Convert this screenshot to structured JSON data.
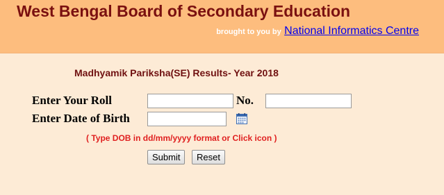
{
  "header": {
    "title": "West Bengal Board of Secondary Education",
    "brought_by": "brought to you by",
    "nic_link": "National Informatics Centre"
  },
  "form": {
    "heading": "Madhyamik Pariksha(SE) Results- Year 2018",
    "roll_label": "Enter Your Roll",
    "roll_value": "",
    "no_label": "No.",
    "no_value": "",
    "dob_label": "Enter Date of Birth",
    "dob_value": "",
    "dob_hint": "( Type DOB in dd/mm/yyyy format or Click icon   )",
    "calendar_icon": "calendar-icon",
    "submit_label": "Submit",
    "reset_label": "Reset"
  },
  "colors": {
    "header_bg": "#fdbd7e",
    "page_bg": "#fdebd6",
    "title": "#7a1010",
    "link": "#0000ee",
    "hint": "#e02020"
  }
}
